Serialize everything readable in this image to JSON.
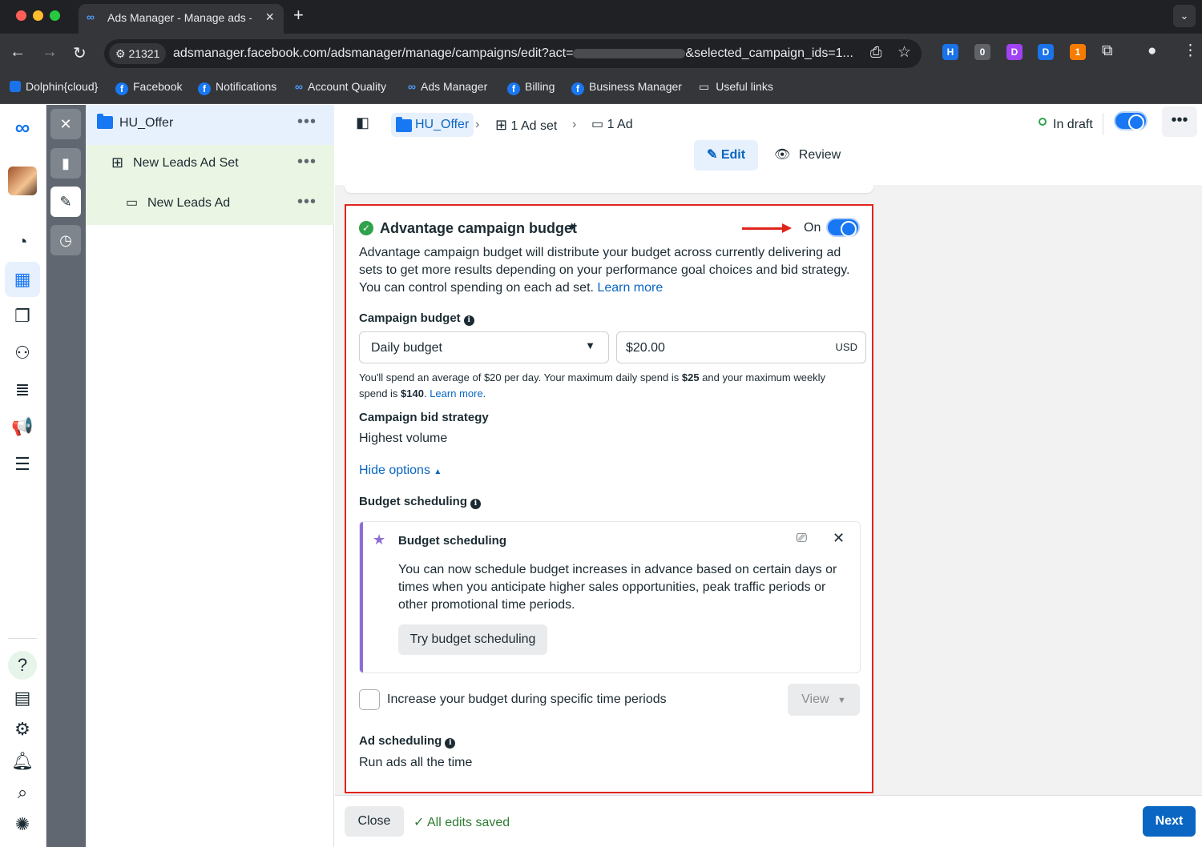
{
  "browser": {
    "tab_title": "Ads Manager - Manage ads -",
    "site_chip": "21321",
    "url_prefix": "adsmanager.facebook.com/adsmanager/manage/campaigns/edit?act=",
    "url_suffix": "&selected_campaign_ids=1...",
    "ext_badges": [
      "0",
      "1"
    ],
    "bookmarks": [
      "Dolphin{cloud}",
      "Facebook",
      "Notifications",
      "Account Quality",
      "Ads Manager",
      "Billing",
      "Business Manager",
      "Useful links"
    ]
  },
  "tree": {
    "campaign": "HU_Offer",
    "adset": "New Leads Ad Set",
    "ad": "New Leads Ad"
  },
  "topbar": {
    "crumb_campaign": "HU_Offer",
    "crumb_adset": "1 Ad set",
    "crumb_ad": "1 Ad",
    "status": "In draft",
    "edit_label": "Edit",
    "review_label": "Review"
  },
  "card": {
    "title": "Advantage campaign budget",
    "toggle_label": "On",
    "description": "Advantage campaign budget will distribute your budget across currently delivering ad sets to get more results depending on your performance goal choices and bid strategy. You can control spending on each ad set.",
    "learn_more": "Learn more",
    "budget_label": "Campaign budget",
    "budget_type": "Daily budget",
    "budget_value": "$20.00",
    "currency": "USD",
    "spend_note_1": "You'll spend an average of $20 per day. Your maximum daily spend is ",
    "spend_max_daily": "$25",
    "spend_note_2": " and your maximum weekly spend is ",
    "spend_max_weekly": "$140",
    "spend_note_3": ". ",
    "spend_learn_more": "Learn more.",
    "bid_label": "Campaign bid strategy",
    "bid_value": "Highest volume",
    "hide_options": "Hide options",
    "sched_label": "Budget scheduling",
    "promo_title": "Budget scheduling",
    "promo_body": "You can now schedule budget increases in advance based on certain days or times when you anticipate higher sales opportunities, peak traffic periods or other promotional time periods.",
    "promo_button": "Try budget scheduling",
    "increase_label": "Increase your budget during specific time periods",
    "view_button": "View",
    "ad_sched_label": "Ad scheduling",
    "ad_sched_value": "Run ads all the time"
  },
  "footer": {
    "close": "Close",
    "saved": "All edits saved",
    "next": "Next"
  },
  "colors": {
    "accent": "#1877f2",
    "link": "#0a66c2",
    "highlight_border": "#e0241c",
    "success": "#31a24c"
  }
}
